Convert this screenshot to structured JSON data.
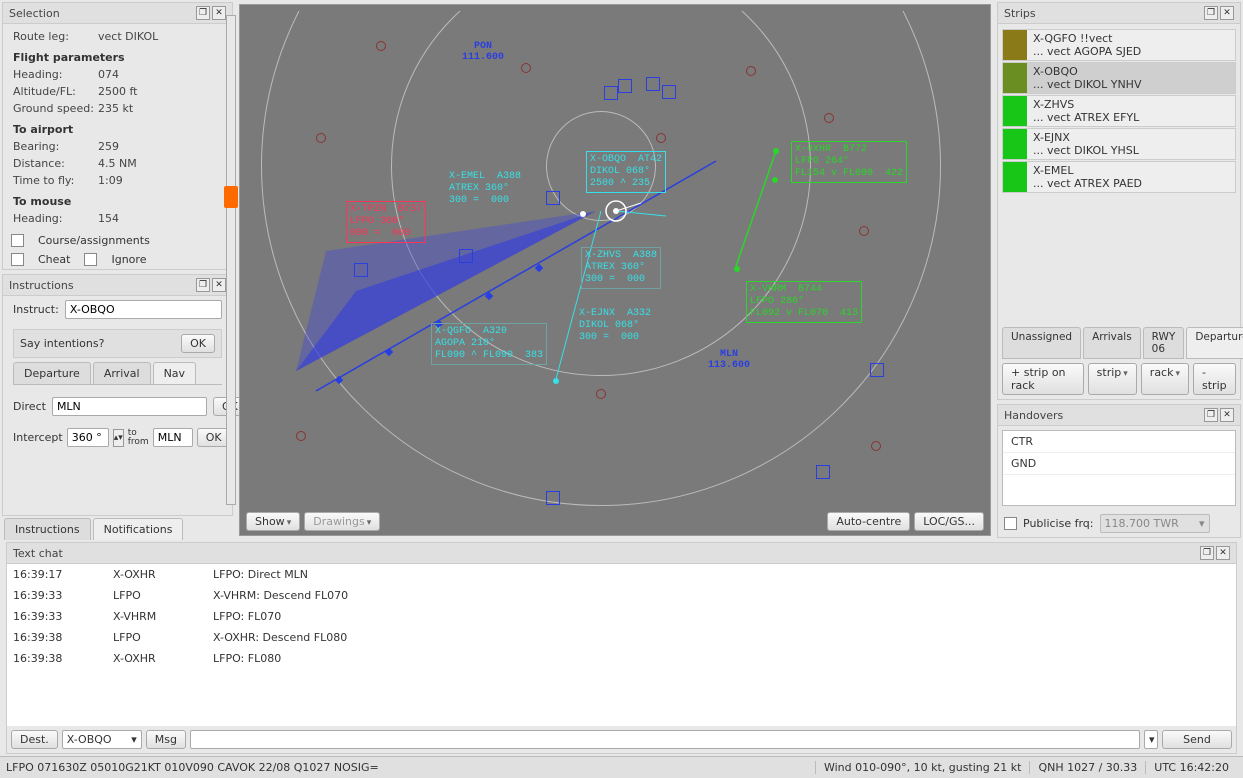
{
  "selection": {
    "title": "Selection",
    "route_leg_label": "Route leg:",
    "route_leg_value": "vect DIKOL",
    "fp_heading": "Flight parameters",
    "heading_label": "Heading:",
    "heading_value": "074",
    "altfl_label": "Altitude/FL:",
    "altfl_value": "2500 ft",
    "gs_label": "Ground speed:",
    "gs_value": "235 kt",
    "to_airport_heading": "To airport",
    "bearing_label": "Bearing:",
    "bearing_value": "259",
    "distance_label": "Distance:",
    "distance_value": "4.5 NM",
    "ttf_label": "Time to fly:",
    "ttf_value": "1:09",
    "to_mouse_heading": "To mouse",
    "mouse_hdg_label": "Heading:",
    "mouse_hdg_value": "154",
    "course_label": "Course/assignments",
    "cheat_label": "Cheat",
    "ignore_label": "Ignore"
  },
  "instructions": {
    "title": "Instructions",
    "instruct_label": "Instruct:",
    "instruct_value": "X-OBQO",
    "say_intentions_label": "Say intentions?",
    "ok_label": "OK",
    "tabs": {
      "departure": "Departure",
      "arrival": "Arrival",
      "nav": "Nav"
    },
    "direct_label": "Direct",
    "direct_value": "MLN",
    "intercept_label": "Intercept",
    "intercept_deg": "360 °",
    "tofrom_label": "to\nfrom",
    "intercept_fix": "MLN"
  },
  "lower_tabs": {
    "instructions": "Instructions",
    "notifications": "Notifications"
  },
  "scope_buttons": {
    "show": "Show",
    "drawings": "Drawings",
    "autocentre": "Auto-centre",
    "locgs": "LOC/GS..."
  },
  "scope": {
    "pon_label": "PON\n111.600",
    "mln_label": "MLN\n113.600"
  },
  "datablocks": {
    "obqo": "X-OBQO  AT42\nDIKOL 068°\n2500 ^ 235",
    "emel": "X-EMEL  A388\nATREX 360°\n300 =  000",
    "oxhr": "X-OXHR  B772\nLFPO 264°\nFL154 v FL080  422",
    "zhvs": "X-ZHVS  A388\nATREX 360°\n300 =  000",
    "ejnx": "X-EJNX  A332\nDIKOL 068°\n300 =  000",
    "qgfo": "X-QGFO  A320\nAGOPA 210°\nFL090 ^ FL090  383",
    "vhrm": "X-VHRM  B744\nLFPO 286°\nFL092 v FL070  413",
    "red1": "X-TPZN  B737\nLFPO 360°\n000 =  000"
  },
  "strips": {
    "title": "Strips",
    "items": [
      {
        "color": "#8a7a18",
        "line1": "X-QGFO  !!vect",
        "line2": "... vect AGOPA  SJED",
        "sel": false
      },
      {
        "color": "#6b8e23",
        "line1": "X-OBQO",
        "line2": "... vect DIKOL  YNHV",
        "sel": true
      },
      {
        "color": "#17c617",
        "line1": "X-ZHVS",
        "line2": "... vect ATREX  EFYL",
        "sel": false
      },
      {
        "color": "#17c617",
        "line1": "X-EJNX",
        "line2": "... vect DIKOL  YHSL",
        "sel": false
      },
      {
        "color": "#17c617",
        "line1": "X-EMEL",
        "line2": "... vect ATREX  PAED",
        "sel": false
      }
    ],
    "tabs": {
      "unassigned": "Unassigned",
      "arrivals": "Arrivals",
      "rwy06": "RWY 06",
      "departures": "Departures"
    },
    "btns": {
      "stripOnRack": "+ strip on rack",
      "strip": "strip",
      "rack": "rack",
      "minus": "- strip"
    }
  },
  "handovers": {
    "title": "Handovers",
    "items": [
      "CTR",
      "GND"
    ],
    "publicise_label": "Publicise frq:",
    "freq_value": "118.700  TWR"
  },
  "chat": {
    "title": "Text chat",
    "rows": [
      {
        "t": "16:39:17",
        "src": "X-OXHR",
        "msg": "LFPO: Direct MLN"
      },
      {
        "t": "16:39:33",
        "src": "LFPO",
        "msg": "X-VHRM: Descend FL070"
      },
      {
        "t": "16:39:33",
        "src": "X-VHRM",
        "msg": "LFPO: FL070"
      },
      {
        "t": "16:39:38",
        "src": "LFPO",
        "msg": "X-OXHR: Descend FL080"
      },
      {
        "t": "16:39:38",
        "src": "X-OXHR",
        "msg": "LFPO: FL080"
      }
    ],
    "dest_label": "Dest.",
    "dest_value": "X-OBQO",
    "msg_label": "Msg",
    "send_label": "Send"
  },
  "status": {
    "left": "LFPO 071630Z 05010G21KT 010V090 CAVOK 22/08 Q1027 NOSIG=",
    "wind": "Wind 010-090°, 10 kt, gusting 21 kt",
    "qnh": "QNH 1027 / 30.33",
    "utc": "UTC 16:42:20"
  }
}
